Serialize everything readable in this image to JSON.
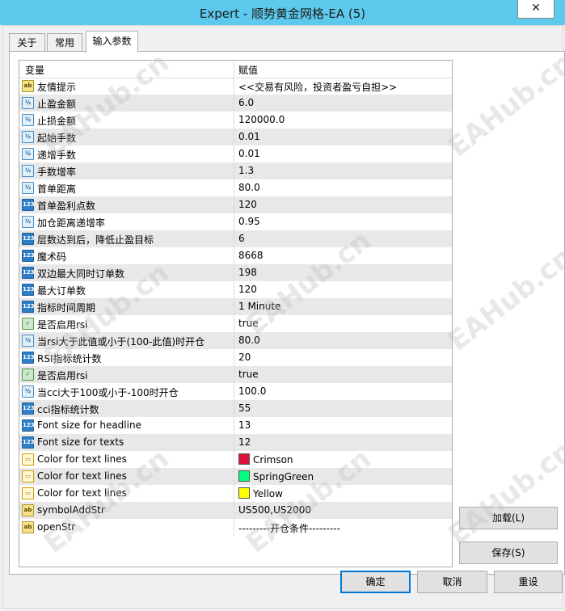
{
  "window": {
    "title": "Expert - 顺势黄金网格-EA (5)",
    "close_glyph": "✕"
  },
  "tabs": [
    {
      "label": "关于",
      "active": false
    },
    {
      "label": "常用",
      "active": false
    },
    {
      "label": "输入参数",
      "active": true
    }
  ],
  "grid": {
    "headers": {
      "variable": "变量",
      "value": "赋值"
    },
    "rows": [
      {
        "type": "ab",
        "icon_text": "ab",
        "name": "友情提示",
        "value": "<<交易有风险，投资者盈亏自担>>"
      },
      {
        "type": "half",
        "icon_text": "½",
        "name": "止盈金额",
        "value": "6.0"
      },
      {
        "type": "half",
        "icon_text": "½",
        "name": "止损金额",
        "value": "120000.0"
      },
      {
        "type": "half",
        "icon_text": "½",
        "name": "起始手数",
        "value": "0.01"
      },
      {
        "type": "half",
        "icon_text": "½",
        "name": "递增手数",
        "value": "0.01"
      },
      {
        "type": "half",
        "icon_text": "½",
        "name": "手数增率",
        "value": "1.3"
      },
      {
        "type": "half",
        "icon_text": "½",
        "name": "首单距离",
        "value": "80.0"
      },
      {
        "type": "num",
        "icon_text": "123",
        "name": "首单盈利点数",
        "value": "120"
      },
      {
        "type": "half",
        "icon_text": "½",
        "name": "加仓距离递增率",
        "value": "0.95"
      },
      {
        "type": "num",
        "icon_text": "123",
        "name": "层数达到后，降低止盈目标",
        "value": "6"
      },
      {
        "type": "num",
        "icon_text": "123",
        "name": "魔术码",
        "value": "8668"
      },
      {
        "type": "num",
        "icon_text": "123",
        "name": "双边最大同时订单数",
        "value": "198"
      },
      {
        "type": "num",
        "icon_text": "123",
        "name": "最大订单数",
        "value": "120"
      },
      {
        "type": "num",
        "icon_text": "123",
        "name": "指标时间周期",
        "value": "1 Minute"
      },
      {
        "type": "bool",
        "icon_text": "✓",
        "name": "是否启用rsi",
        "value": "true"
      },
      {
        "type": "half",
        "icon_text": "½",
        "name": "当rsi大于此值或小于(100-此值)时开仓",
        "value": "80.0"
      },
      {
        "type": "num",
        "icon_text": "123",
        "name": "RSI指标统计数",
        "value": "20"
      },
      {
        "type": "bool",
        "icon_text": "✓",
        "name": "是否启用rsi",
        "value": "true"
      },
      {
        "type": "half",
        "icon_text": "½",
        "name": "当cci大于100或小于-100时开仓",
        "value": "100.0"
      },
      {
        "type": "num",
        "icon_text": "123",
        "name": "cci指标统计数",
        "value": "55"
      },
      {
        "type": "num",
        "icon_text": "123",
        "name": "Font size for headline",
        "value": "13"
      },
      {
        "type": "num",
        "icon_text": "123",
        "name": "Font size for texts",
        "value": "12"
      },
      {
        "type": "clr",
        "icon_text": "▭",
        "name": "Color for text lines",
        "value": "Crimson",
        "swatch": "#dc143c"
      },
      {
        "type": "clr",
        "icon_text": "▭",
        "name": "Color for text lines",
        "value": "SpringGreen",
        "swatch": "#00ff7f"
      },
      {
        "type": "clr",
        "icon_text": "▭",
        "name": "Color for text lines",
        "value": "Yellow",
        "swatch": "#ffff00"
      },
      {
        "type": "ab",
        "icon_text": "ab",
        "name": "symbolAddStr",
        "value": "US500,US2000"
      },
      {
        "type": "ab",
        "icon_text": "ab",
        "name": "openStr",
        "value": "---------开仓条件---------"
      }
    ]
  },
  "buttons": {
    "load": "加载(L)",
    "save": "保存(S)",
    "ok": "确定",
    "cancel": "取消",
    "reset": "重设"
  },
  "watermark": "EAHub.cn"
}
